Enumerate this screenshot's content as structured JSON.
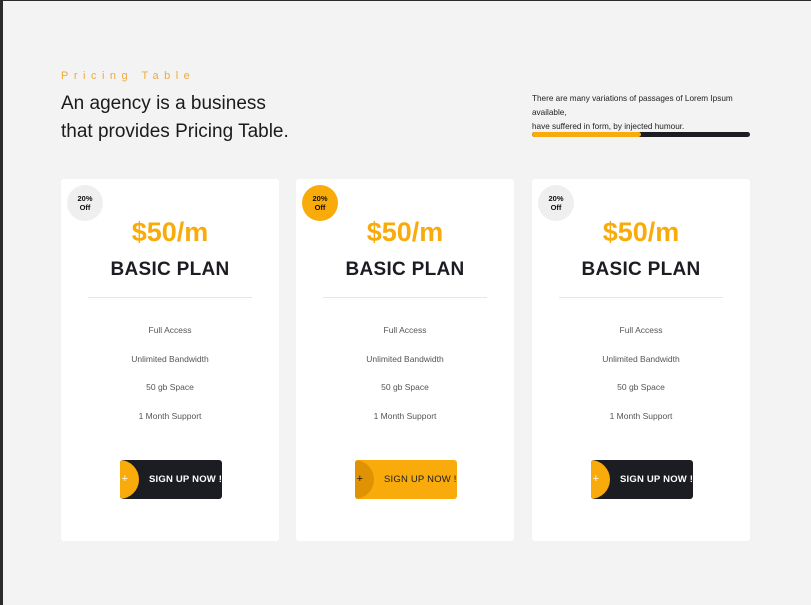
{
  "header": {
    "eyebrow": "Pricing Table",
    "title_line1": "An agency is a business",
    "title_line2": "that provides Pricing Table.",
    "blurb_line1": "There are many variations of passages of Lorem Ipsum available,",
    "blurb_line2": "have suffered in form, by injected humour.",
    "progress_percent": 50
  },
  "colors": {
    "accent": "#f8ab0a",
    "dark": "#1b1d22",
    "background": "#f3f3f3"
  },
  "plans": [
    {
      "badge_line1": "20%",
      "badge_line2": "Off",
      "badge_style": "gray",
      "price": "$50/m",
      "name": "BASIC PLAN",
      "features": [
        "Full Access",
        "Unlimited Bandwidth",
        "50 gb Space",
        "1 Month Support"
      ],
      "button_icon": "+",
      "button_label": "SIGN UP NOW !",
      "button_style": "dark"
    },
    {
      "badge_line1": "20%",
      "badge_line2": "Off",
      "badge_style": "accent",
      "price": "$50/m",
      "name": "BASIC PLAN",
      "features": [
        "Full Access",
        "Unlimited Bandwidth",
        "50 gb Space",
        "1 Month Support"
      ],
      "button_icon": "+",
      "button_label": "SIGN UP NOW !",
      "button_style": "accent"
    },
    {
      "badge_line1": "20%",
      "badge_line2": "Off",
      "badge_style": "gray",
      "price": "$50/m",
      "name": "BASIC PLAN",
      "features": [
        "Full Access",
        "Unlimited Bandwidth",
        "50 gb Space",
        "1 Month Support"
      ],
      "button_icon": "+",
      "button_label": "SIGN UP NOW !",
      "button_style": "dark"
    }
  ]
}
